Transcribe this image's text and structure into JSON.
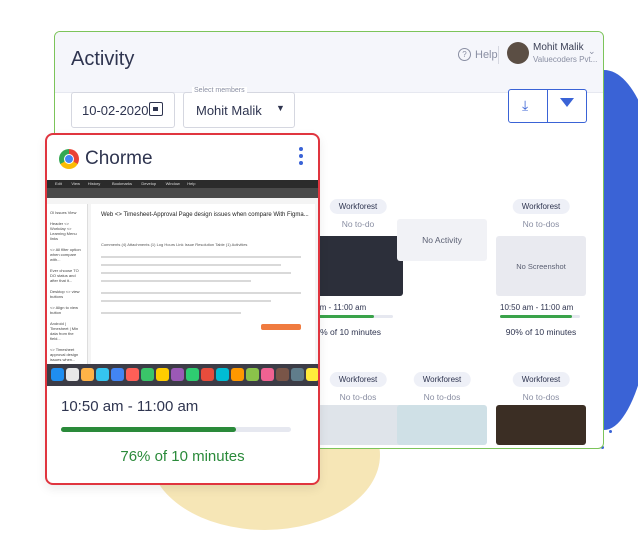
{
  "header": {
    "title": "Activity",
    "help_label": "Help",
    "user_name": "Mohit Malik",
    "user_org": "Valuecoders Pvt..."
  },
  "filters": {
    "date": "10-02-2020",
    "members_legend": "Select members",
    "member": "Mohit Malik"
  },
  "tiles": [
    {
      "project": "Workforest",
      "todo": "No to-do",
      "time": "...m - 11:00 am",
      "pct_label": "...% of 10 minutes",
      "progress": 0.76
    },
    {
      "project": "",
      "todo": "",
      "shot_text": "No Activity"
    },
    {
      "project": "Workforest",
      "todo": "No to-dos",
      "shot_text": "No Screenshot",
      "time": "10:50 am - 11:00 am",
      "pct_label": "90% of 10 minutes",
      "progress": 0.9
    },
    {
      "project": "Workforest",
      "todo": "No to-dos"
    },
    {
      "project": "Workforest",
      "todo": "No to-dos"
    },
    {
      "project": "Workforest",
      "todo": "No to-dos"
    }
  ],
  "card": {
    "title": "Chorme",
    "time": "10:50 am - 11:00 am",
    "pct_label": "76% of 10 minutes",
    "progress": 0.76,
    "screenshot": {
      "menu": [
        "Edit",
        "View",
        "History",
        "Bookmarks",
        "Develop",
        "Window",
        "Help"
      ],
      "page_title": "Web <> Timesheet-Approval Page design issues when compare With Figma...",
      "tabs_text": "Comments (4)   Attachments (1)   Log Hours   Link Issue   Resolution   Table (1)   Activities",
      "sidebar_items": [
        "Ol Issues View",
        "Header <> Workday <> Learning Menu links",
        "<> All filter option when compare with...",
        "Ever choose TO DO status and after that it...",
        "Desktop <> view buttons",
        "<> Align to view button",
        "Android | Timesheet | Min data from the field...",
        "<> Timesheet approval design issues when..."
      ]
    }
  },
  "colors": {
    "accent": "#3a63d6",
    "success": "#2a8a3a",
    "card_border": "#e0353f",
    "panel_border": "#7cc45a"
  }
}
